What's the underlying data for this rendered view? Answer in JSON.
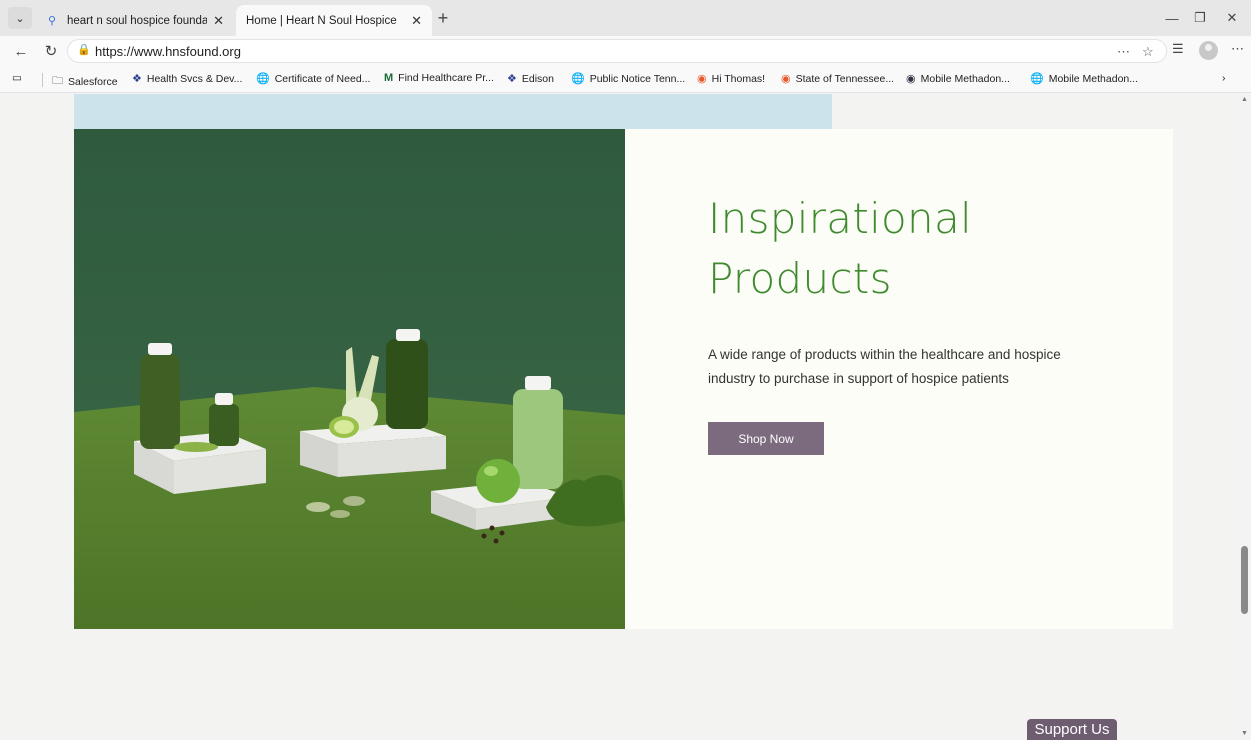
{
  "tabs": [
    {
      "title": "heart n soul hospice foundation -",
      "icon": "search-icon",
      "active": false
    },
    {
      "title": "Home | Heart N Soul Hospice",
      "active": true
    }
  ],
  "address": {
    "url": "https://www.hnsfound.org"
  },
  "bookmarks": [
    {
      "label": "Salesforce",
      "icon": "folder-icon"
    },
    {
      "label": "Health Svcs & Dev...",
      "icon": "tennessee-seal-icon"
    },
    {
      "label": "Certificate of Need...",
      "icon": "globe-icon"
    },
    {
      "label": "Find Healthcare Pr...",
      "icon": "m-logo-icon"
    },
    {
      "label": "Edison",
      "icon": "tennessee-seal-icon"
    },
    {
      "label": "Public Notice Tenn...",
      "icon": "globe-icon"
    },
    {
      "label": "Hi Thomas!",
      "icon": "orange-ring-icon"
    },
    {
      "label": "State of Tennessee...",
      "icon": "orange-ring-icon"
    },
    {
      "label": "Mobile Methadon...",
      "icon": "circle-logo-icon"
    },
    {
      "label": "Mobile Methadon...",
      "icon": "globe-icon"
    }
  ],
  "page": {
    "heading_line1": "Inspirational",
    "heading_line2": "Products",
    "description": "A wide range of products within the healthcare and hospice industry to purchase in support of hospice patients",
    "shop_button": "Shop Now",
    "support_button": "Support Us"
  },
  "colors": {
    "heading": "#3f8a2f",
    "button": "#7c6a7e",
    "card_bg": "#fcfdf6",
    "top_band": "#cde3eb"
  }
}
